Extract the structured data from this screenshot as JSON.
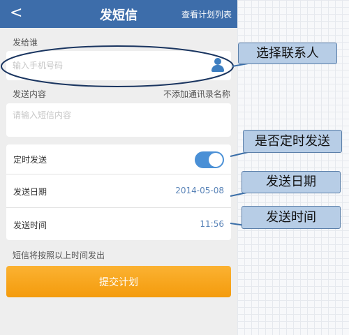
{
  "header": {
    "back_icon": "chevron-left-icon",
    "back_glyph": "<",
    "title": "发短信",
    "view_plans_link": "查看计划列表"
  },
  "form": {
    "recipient_label": "发给谁",
    "recipient_placeholder": "输入手机号码",
    "contact_icon": "person-icon",
    "content_label": "发送内容",
    "no_contact_name_note": "不添加通讯录名称",
    "content_placeholder": "请输入短信内容",
    "scheduled_label": "定时发送",
    "scheduled_on": true,
    "date_label": "发送日期",
    "date_value": "2014-05-08",
    "time_label": "发送时间",
    "time_value": "11:56",
    "hint": "短信将按照以上时间发出",
    "submit_label": "提交计划"
  },
  "annotations": {
    "select_contact": "选择联系人",
    "scheduled_toggle": "是否定时发送",
    "send_date": "发送日期",
    "send_time": "发送时间"
  },
  "colors": {
    "topbar": "#3d6daa",
    "submit": "#f6a11a",
    "toggle": "#4a90d6",
    "callout": "#b7cde6"
  }
}
